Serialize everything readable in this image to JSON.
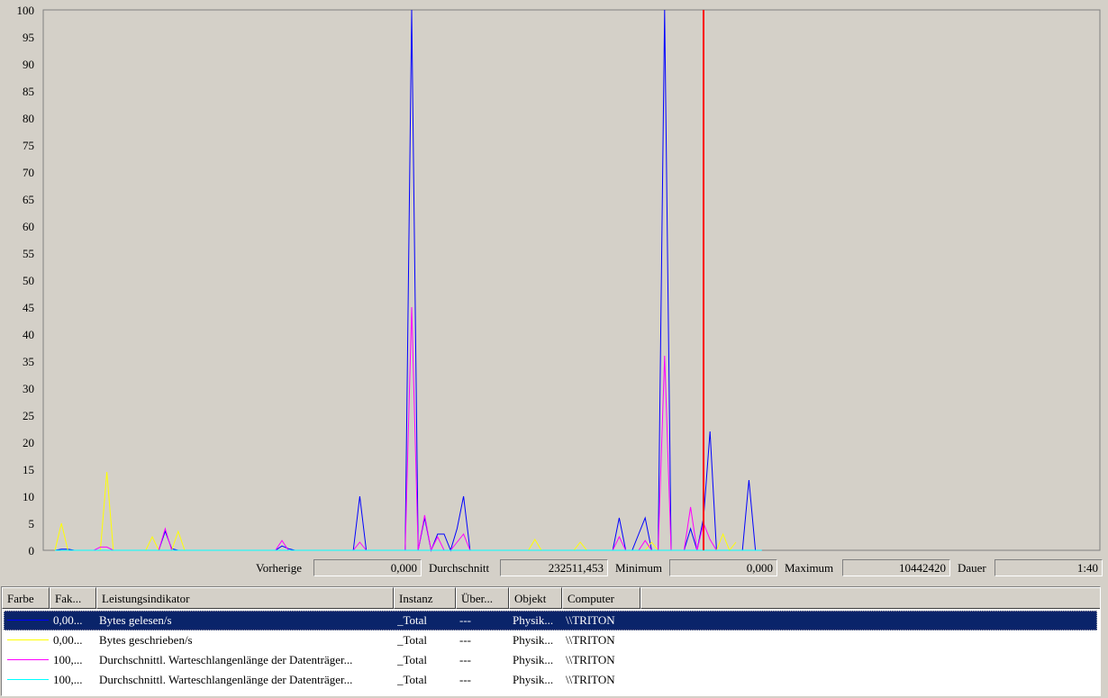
{
  "chart_data": {
    "type": "line",
    "ylim": [
      0,
      100
    ],
    "yticks": [
      0,
      5,
      10,
      15,
      20,
      25,
      30,
      35,
      40,
      45,
      50,
      55,
      60,
      65,
      70,
      75,
      80,
      85,
      90,
      95,
      100
    ],
    "x": [
      0,
      1,
      2,
      3,
      4,
      5,
      6,
      7,
      8,
      9,
      10,
      11,
      12,
      13,
      14,
      15,
      16,
      17,
      18,
      19,
      20,
      21,
      22,
      23,
      24,
      25,
      26,
      27,
      28,
      29,
      30,
      31,
      32,
      33,
      34,
      35,
      36,
      37,
      38,
      39,
      40,
      41,
      42,
      43,
      44,
      45,
      46,
      47,
      48,
      49,
      50,
      51,
      52,
      53,
      54,
      55,
      56,
      57,
      58,
      59,
      60,
      61,
      62,
      63,
      64,
      65,
      66,
      67,
      68,
      69,
      70,
      71,
      72,
      73,
      74,
      75,
      76,
      77,
      78,
      79,
      80,
      81,
      82,
      83,
      84,
      85,
      86,
      87,
      88,
      89,
      90,
      91,
      92,
      93,
      94,
      95,
      96,
      97,
      98,
      99,
      100
    ],
    "time_bar_index": 100,
    "series": [
      {
        "name": "Bytes gelesen/s",
        "color": "#0000ff",
        "values": [
          0,
          0.2,
          0.2,
          0,
          0,
          0,
          0,
          0,
          0,
          0,
          0,
          0,
          0,
          0,
          0,
          0,
          0,
          3.5,
          0.3,
          0,
          0,
          0,
          0,
          0,
          0,
          0,
          0,
          0,
          0,
          0,
          0,
          0,
          0,
          0,
          0,
          0.8,
          0.3,
          0,
          0,
          0,
          0,
          0,
          0,
          0,
          0,
          0,
          0,
          10,
          0,
          0,
          0,
          0,
          0,
          0,
          0,
          100,
          0,
          6,
          0,
          3,
          3,
          0,
          4,
          10,
          0,
          0,
          0,
          0,
          0,
          0,
          0,
          0,
          0,
          0,
          0,
          0,
          0,
          0,
          0,
          0,
          0,
          0,
          0,
          0,
          0,
          0,
          0,
          6,
          0,
          0,
          3,
          6,
          0,
          0,
          100,
          0,
          0,
          0,
          4,
          0,
          6,
          22,
          0,
          0,
          0,
          0,
          0,
          13,
          0,
          0
        ]
      },
      {
        "name": "Bytes geschrieben/s",
        "color": "#ffff00",
        "values": [
          0,
          5,
          0,
          0,
          0,
          0,
          0,
          0,
          14.5,
          0,
          0,
          0,
          0,
          0,
          0,
          2.5,
          0,
          0,
          0,
          3.5,
          0,
          0,
          0,
          0,
          0,
          0,
          0,
          0,
          0,
          0,
          0,
          0,
          0,
          0,
          0,
          0,
          0,
          0,
          0,
          0,
          0,
          0,
          0,
          0,
          0,
          0,
          0,
          0,
          0,
          0,
          0,
          0,
          0,
          0,
          0,
          0,
          0,
          0,
          0,
          0,
          0,
          0,
          0,
          0,
          0,
          0,
          0,
          0,
          0,
          0,
          0,
          0,
          0,
          0,
          2,
          0,
          0,
          0,
          0,
          0,
          0,
          1.5,
          0,
          0,
          0,
          0,
          0,
          0,
          0,
          0,
          0,
          0,
          1.5,
          0,
          0,
          0,
          0,
          0,
          0,
          0,
          0,
          0,
          0,
          3,
          0,
          1.5
        ]
      },
      {
        "name": "Durchschnittl. Warteschlangenlänge der Datenträger...",
        "color": "#ff00ff",
        "values": [
          0,
          0,
          0,
          0,
          0,
          0,
          0,
          0.6,
          0.6,
          0,
          0,
          0,
          0,
          0,
          0,
          0,
          0,
          4,
          0,
          0,
          0,
          0,
          0,
          0,
          0,
          0,
          0,
          0,
          0,
          0,
          0,
          0,
          0,
          0,
          0,
          1.8,
          0,
          0,
          0,
          0,
          0,
          0,
          0,
          0,
          0,
          0,
          0,
          1.5,
          0,
          0,
          0,
          0,
          0,
          0,
          0,
          45,
          0,
          6.5,
          0,
          2.5,
          0,
          0,
          1.5,
          3,
          0,
          0,
          0,
          0,
          0,
          0,
          0,
          0,
          0,
          0,
          0,
          0,
          0,
          0,
          0,
          0,
          0,
          0,
          0,
          0,
          0,
          0,
          0,
          2.5,
          0,
          0,
          0,
          1.8,
          0,
          0,
          36,
          0,
          0,
          0,
          8,
          0,
          5,
          2,
          0,
          0,
          0,
          0,
          0,
          0,
          0,
          0
        ]
      },
      {
        "name": "Durchschnittl. Warteschlangenlänge der Datenträger...",
        "color": "#00ffff",
        "values": [
          0,
          0,
          0,
          0,
          0,
          0,
          0,
          0,
          0,
          0,
          0,
          0,
          0,
          0,
          0,
          0,
          0,
          0,
          0,
          0,
          0,
          0,
          0,
          0,
          0,
          0,
          0,
          0,
          0,
          0,
          0,
          0,
          0,
          0,
          0,
          0,
          0,
          0,
          0,
          0,
          0,
          0,
          0,
          0,
          0,
          0,
          0,
          0,
          0,
          0,
          0,
          0,
          0,
          0,
          0,
          0,
          0,
          0,
          0,
          0,
          0,
          0,
          0,
          0,
          0,
          0,
          0,
          0,
          0,
          0,
          0,
          0,
          0,
          0,
          0,
          0,
          0,
          0,
          0,
          0,
          0,
          0,
          0,
          0,
          0,
          0,
          0,
          0,
          0,
          0,
          0,
          0,
          0,
          0,
          0,
          0,
          0,
          0,
          0,
          0,
          0,
          0,
          0,
          0,
          0,
          0,
          0,
          0,
          0,
          0
        ]
      }
    ]
  },
  "stats": {
    "previous_label": "Vorherige",
    "previous_value": "0,000",
    "average_label": "Durchschnitt",
    "average_value": "232511,453",
    "minimum_label": "Minimum",
    "minimum_value": "0,000",
    "maximum_label": "Maximum",
    "maximum_value": "10442420",
    "duration_label": "Dauer",
    "duration_value": "1:40"
  },
  "list": {
    "headers": [
      "Farbe",
      "Fak...",
      "Leistungsindikator",
      "Instanz",
      "Über...",
      "Objekt",
      "Computer"
    ],
    "rows": [
      {
        "color": "#0000ff",
        "factor": "0,00...",
        "counter": "Bytes gelesen/s",
        "instance": "_Total",
        "parent": "---",
        "object": "Physik...",
        "computer": "\\\\TRITON"
      },
      {
        "color": "#ffff00",
        "factor": "0,00...",
        "counter": "Bytes geschrieben/s",
        "instance": "_Total",
        "parent": "---",
        "object": "Physik...",
        "computer": "\\\\TRITON"
      },
      {
        "color": "#ff00ff",
        "factor": "100,...",
        "counter": "Durchschnittl. Warteschlangenlänge der Datenträger...",
        "instance": "_Total",
        "parent": "---",
        "object": "Physik...",
        "computer": "\\\\TRITON"
      },
      {
        "color": "#00ffff",
        "factor": "100,...",
        "counter": "Durchschnittl. Warteschlangenlänge der Datenträger...",
        "instance": "_Total",
        "parent": "---",
        "object": "Physik...",
        "computer": "\\\\TRITON"
      }
    ]
  }
}
